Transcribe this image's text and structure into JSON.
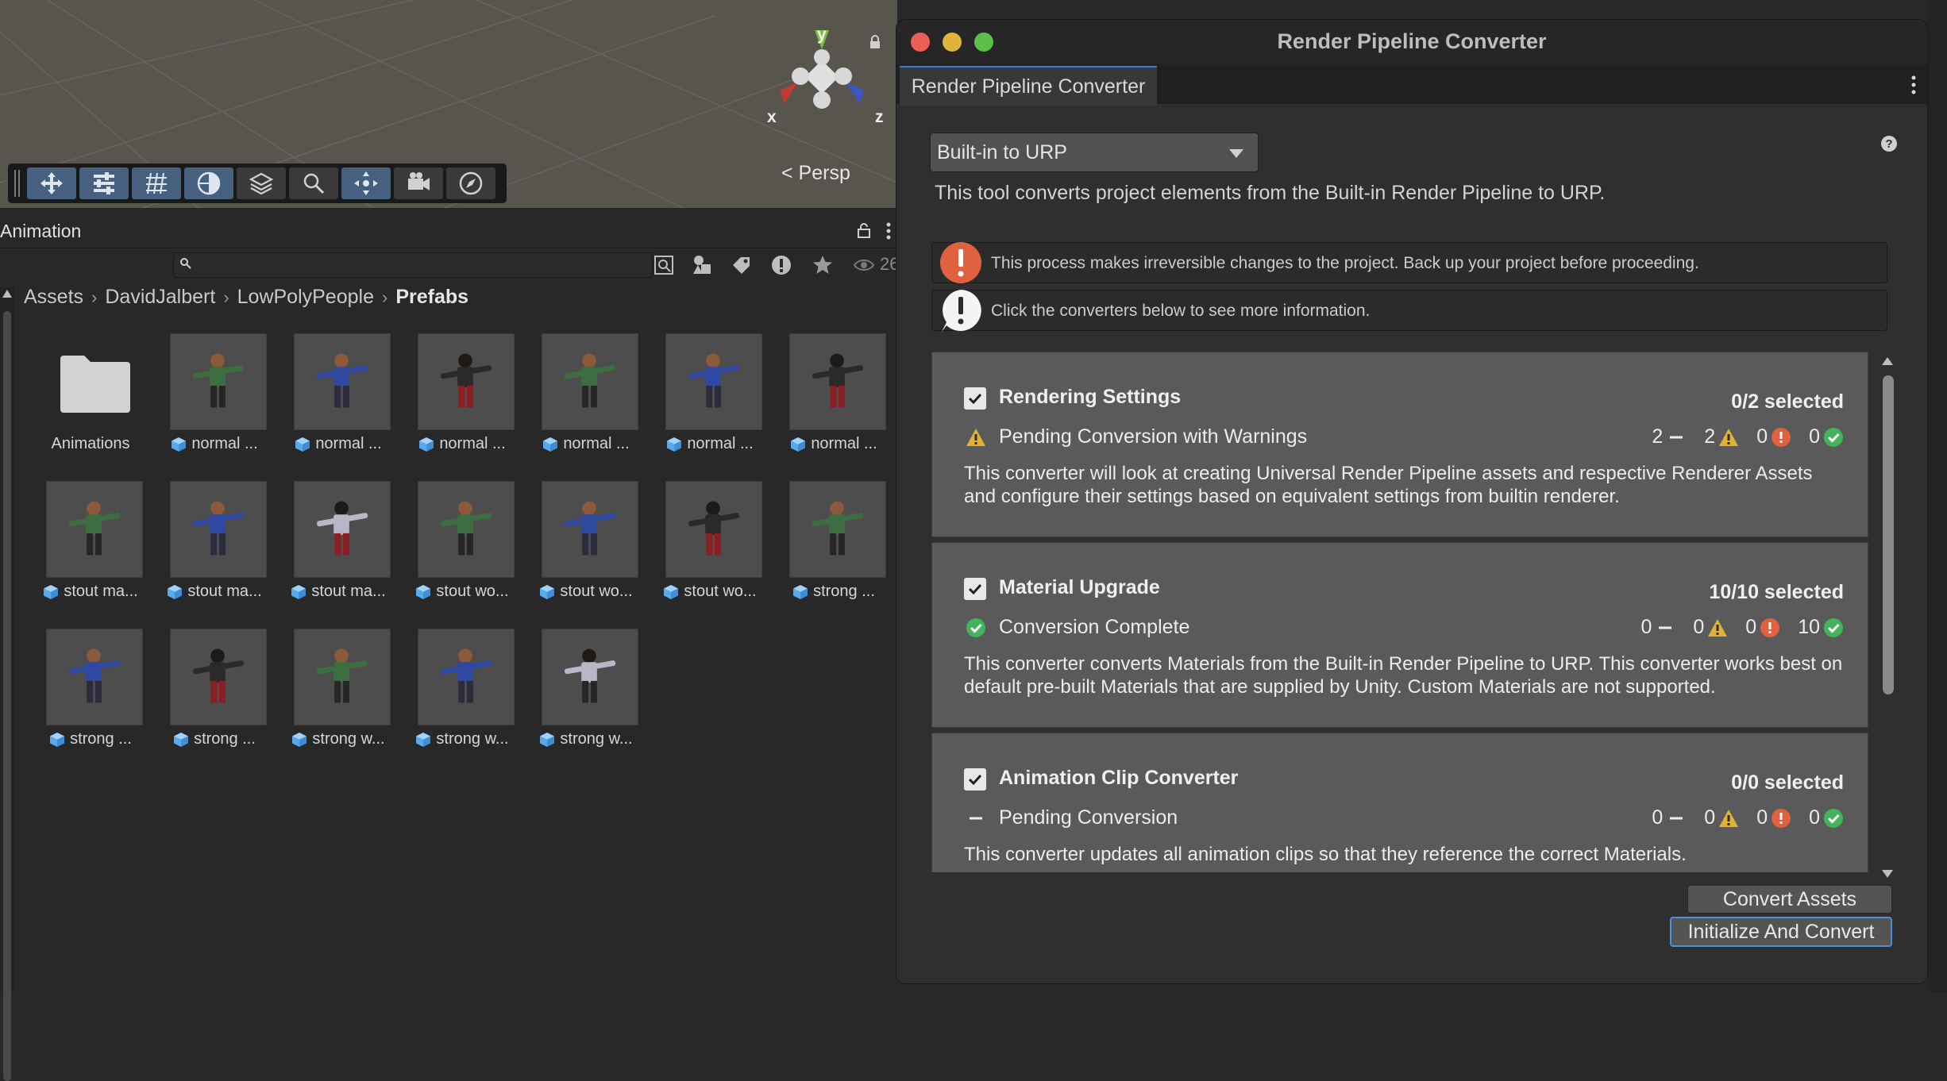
{
  "scene": {
    "persp_label": "< Persp",
    "axes": {
      "x": "x",
      "y": "y",
      "z": "z"
    },
    "tools": [
      "move-tool",
      "rect-tool",
      "grid-tool",
      "view-tool",
      "layers-tool",
      "search-tool",
      "pivot-tool",
      "camera-tool",
      "compass-tool"
    ]
  },
  "project": {
    "panel_title": "Animation",
    "search": {
      "value": "",
      "placeholder": ""
    },
    "eye_count": "26",
    "breadcrumb": [
      "Assets",
      "DavidJalbert",
      "LowPolyPeople",
      "Prefabs"
    ],
    "assets": [
      {
        "label": "Animations",
        "kind": "folder"
      },
      {
        "label": "normal ...",
        "kind": "prefab",
        "shirt": "#3c6e42",
        "pants": "#262626",
        "skin": "#8a5a3a"
      },
      {
        "label": "normal ...",
        "kind": "prefab",
        "shirt": "#2f48a0",
        "pants": "#2b2b3b",
        "skin": "#8a5a3a"
      },
      {
        "label": "normal ...",
        "kind": "prefab",
        "shirt": "#2a2a2a",
        "pants": "#8a1e22",
        "skin": "#1e1a18"
      },
      {
        "label": "normal ...",
        "kind": "prefab",
        "shirt": "#3c6e42",
        "pants": "#262626",
        "skin": "#8a5a3a"
      },
      {
        "label": "normal ...",
        "kind": "prefab",
        "shirt": "#2f48a0",
        "pants": "#2b2b3b",
        "skin": "#8a5a3a"
      },
      {
        "label": "normal ...",
        "kind": "prefab",
        "shirt": "#2a2a2a",
        "pants": "#8a1e22",
        "skin": "#1e1a18"
      },
      {
        "label": "stout ma...",
        "kind": "prefab",
        "shirt": "#3c6e42",
        "pants": "#262626",
        "skin": "#8a5a3a"
      },
      {
        "label": "stout ma...",
        "kind": "prefab",
        "shirt": "#2f48a0",
        "pants": "#2b2b3b",
        "skin": "#8a5a3a"
      },
      {
        "label": "stout ma...",
        "kind": "prefab",
        "shirt": "#b7b7c8",
        "pants": "#8a1e22",
        "skin": "#1e1a18"
      },
      {
        "label": "stout wo...",
        "kind": "prefab",
        "shirt": "#3c6e42",
        "pants": "#262626",
        "skin": "#8a5a3a"
      },
      {
        "label": "stout wo...",
        "kind": "prefab",
        "shirt": "#2f48a0",
        "pants": "#2b2b3b",
        "skin": "#8a5a3a"
      },
      {
        "label": "stout wo...",
        "kind": "prefab",
        "shirt": "#2a2a2a",
        "pants": "#8a1e22",
        "skin": "#1e1a18"
      },
      {
        "label": "strong ...",
        "kind": "prefab",
        "shirt": "#3c6e42",
        "pants": "#262626",
        "skin": "#8a5a3a"
      },
      {
        "label": "strong ...",
        "kind": "prefab",
        "shirt": "#2f48a0",
        "pants": "#2b2b3b",
        "skin": "#8a5a3a"
      },
      {
        "label": "strong ...",
        "kind": "prefab",
        "shirt": "#2a2a2a",
        "pants": "#8a1e22",
        "skin": "#1e1a18"
      },
      {
        "label": "strong w...",
        "kind": "prefab",
        "shirt": "#3c6e42",
        "pants": "#262626",
        "skin": "#8a5a3a"
      },
      {
        "label": "strong w...",
        "kind": "prefab",
        "shirt": "#2f48a0",
        "pants": "#2b2b3b",
        "skin": "#8a5a3a"
      },
      {
        "label": "strong w...",
        "kind": "prefab",
        "shirt": "#b7b7c8",
        "pants": "#262626",
        "skin": "#1e1a18"
      }
    ]
  },
  "converter": {
    "window_title": "Render Pipeline Converter",
    "tab_label": "Render Pipeline Converter",
    "dropdown_value": "Built-in to URP",
    "description": "This tool converts project elements from the Built-in Render Pipeline to URP.",
    "warning_notice": "This process makes irreversible changes to the project. Back up your project before proceeding.",
    "info_notice": "Click the converters below to see more information.",
    "cards": [
      {
        "name": "Rendering Settings",
        "selected": "0/2 selected",
        "checked": true,
        "status": "Pending Conversion with Warnings",
        "status_icon": "warning-icon",
        "counts": [
          "2",
          "2",
          "0",
          "0"
        ],
        "description": "This converter will look at creating Universal Render Pipeline assets and respective Renderer Assets and configure their settings based on equivalent settings from builtin renderer."
      },
      {
        "name": "Material Upgrade",
        "selected": "10/10 selected",
        "checked": true,
        "status": "Conversion Complete",
        "status_icon": "success-icon",
        "counts": [
          "0",
          "0",
          "0",
          "10"
        ],
        "description": "This converter converts Materials from the Built-in Render Pipeline to URP. This converter works best on default pre-built Materials that are supplied by Unity. Custom Materials are not supported."
      },
      {
        "name": "Animation Clip Converter",
        "selected": "0/0 selected",
        "checked": true,
        "status": "Pending Conversion",
        "status_icon": "pending-icon",
        "counts": [
          "0",
          "0",
          "0",
          "0"
        ],
        "description": "This converter updates all animation clips so that they reference the correct Materials."
      }
    ],
    "buttons": {
      "convert": "Convert Assets",
      "initialize": "Initialize And Convert"
    }
  },
  "colors": {
    "accent": "#3b7bd6",
    "warning": "#e2b233",
    "error": "#e0613f",
    "success": "#43b35c",
    "close": "#ec5f57",
    "minimize": "#e0b33a",
    "maximize": "#5cbf4a"
  }
}
